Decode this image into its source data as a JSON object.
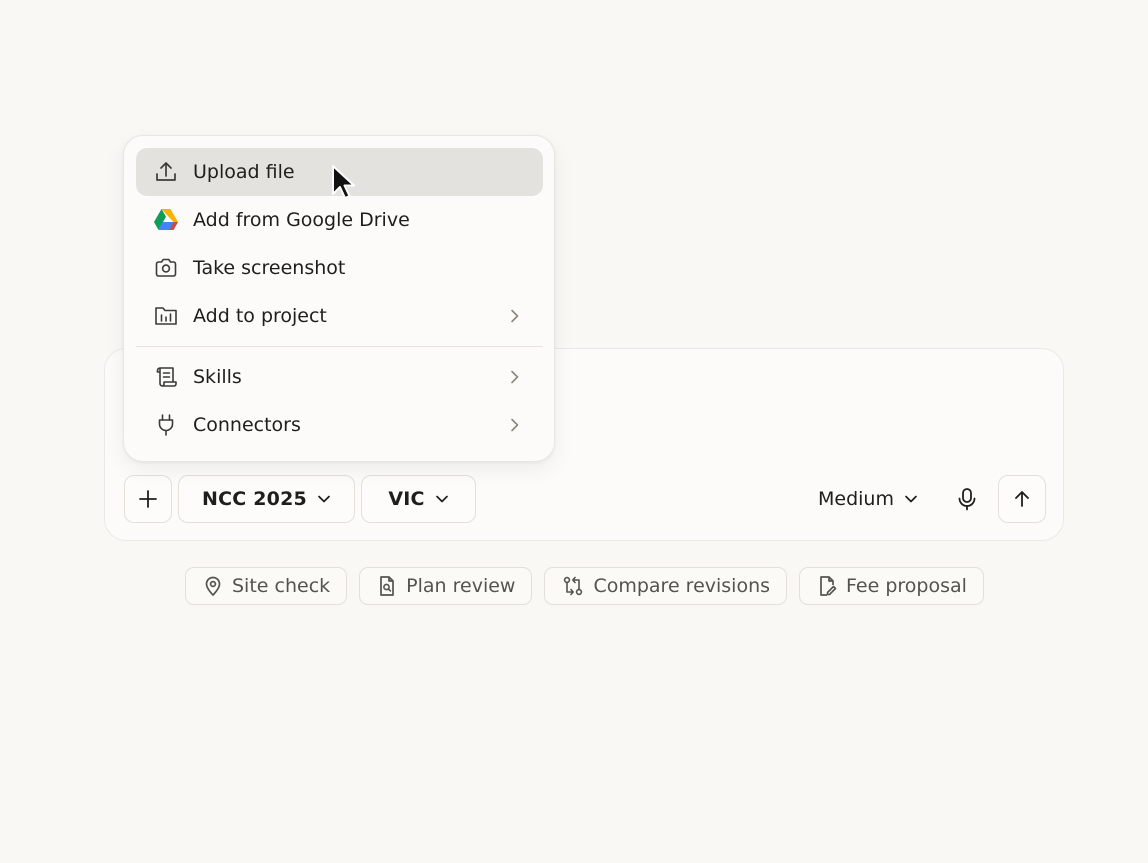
{
  "menu": {
    "items": [
      {
        "label": "Upload file",
        "icon": "upload-icon",
        "active": true
      },
      {
        "label": "Add from Google Drive",
        "icon": "google-drive-icon"
      },
      {
        "label": "Take screenshot",
        "icon": "camera-icon"
      },
      {
        "label": "Add to project",
        "icon": "project-folder-icon",
        "submenu": true
      },
      {
        "label": "Skills",
        "icon": "scroll-icon",
        "submenu": true
      },
      {
        "label": "Connectors",
        "icon": "plug-icon",
        "submenu": true
      }
    ]
  },
  "composer": {
    "standard_label": "NCC 2025",
    "state_label": "VIC",
    "model_label": "Medium"
  },
  "suggestions": [
    {
      "label": "Site check",
      "icon": "map-pin-icon"
    },
    {
      "label": "Plan review",
      "icon": "document-search-icon"
    },
    {
      "label": "Compare revisions",
      "icon": "compare-icon"
    },
    {
      "label": "Fee proposal",
      "icon": "document-edit-icon"
    }
  ],
  "colors": {
    "background": "#f9f8f5",
    "surface": "#fcfbf9",
    "hover": "#e3e2df",
    "border": "#e3e0d9",
    "text": "#1f1e1b",
    "muted_text": "#55534e"
  }
}
